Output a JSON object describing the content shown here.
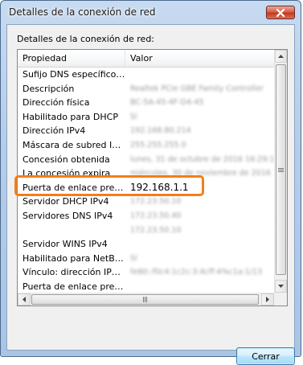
{
  "window": {
    "title": "Detalles de la conexión de red"
  },
  "section_label": "Detalles de la conexión de red:",
  "columns": {
    "property": "Propiedad",
    "value": "Valor"
  },
  "rows": [
    {
      "property": "Sufijo DNS específico p...",
      "value": ""
    },
    {
      "property": "Descripción",
      "value": "Realtek PCIe GBE Family Controller"
    },
    {
      "property": "Dirección física",
      "value": "BC-5A-45-4F-D4-45"
    },
    {
      "property": "Habilitado para DHCP",
      "value": "Sí"
    },
    {
      "property": "Dirección IPv4",
      "value": "192.168.80.214"
    },
    {
      "property": "Máscara de subred IPv4",
      "value": "255.255.255.0"
    },
    {
      "property": "Concesión obtenida",
      "value": "lunes, 31 de octubre de 2016 16:29:15"
    },
    {
      "property": "La concesión expira",
      "value": "miércoles, 30 de noviembre de 2016 16:29"
    },
    {
      "property": "Puerta de enlace predet...",
      "value": "192.168.1.1"
    },
    {
      "property": "Servidor DHCP IPv4",
      "value": "172.23.50.10"
    },
    {
      "property": "Servidores DNS IPv4",
      "value": "172.23.50.40"
    },
    {
      "property": "",
      "value": "172.23.50.10"
    },
    {
      "property": "Servidor WINS IPv4",
      "value": ""
    },
    {
      "property": "Habilitado para NetBios ...",
      "value": "Sí"
    },
    {
      "property": "Vínculo: dirección IPv61...",
      "value": "fe80::f0c4:1c2c:3:4cff:4%c1a:1/13"
    },
    {
      "property": "Puerta de enlace predet...",
      "value": ""
    },
    {
      "property": "Servidor DNS IPv6",
      "value": ""
    }
  ],
  "close_button": {
    "label": "Cerrar"
  },
  "icons": [
    "close-x-icon",
    "scroll-up-arrow-icon",
    "scroll-down-arrow-icon",
    "scroll-left-arrow-icon",
    "scroll-right-arrow-icon",
    "grip-icon"
  ],
  "colors": {
    "highlight": "#f07f1a",
    "close_button_red": "#c4381c",
    "button_blue": "#3c7fb1"
  }
}
